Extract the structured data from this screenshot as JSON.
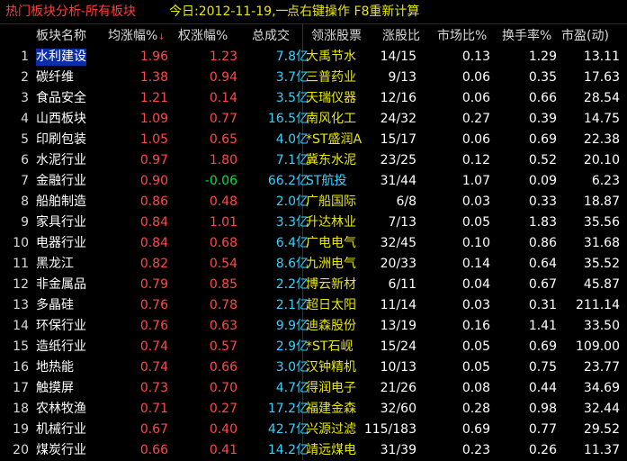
{
  "title_bar": {
    "title": "热门板块分析-所有板块",
    "date": "今日:2012-11-19,一",
    "hint": "点右键操作 F8重新计算"
  },
  "columns": {
    "name": "板块名称",
    "avg_change": "均涨幅%",
    "weighted_change": "权涨幅%",
    "volume": "总成交",
    "leading_stock": "领涨股票",
    "up_ratio": "涨股比",
    "market_ratio": "市场比%",
    "turnover": "换手率%",
    "pe": "市盈(动)",
    "sort_indicator": "↓"
  },
  "volume_unit": "亿",
  "rows": [
    {
      "num": "1",
      "name": "水利建设",
      "avg": "1.96",
      "wchg": "1.23",
      "vol": "7.8",
      "stock": "大禹节水",
      "ratio": "14/15",
      "mkt": "0.13",
      "turn": "1.29",
      "pe": "13.11"
    },
    {
      "num": "2",
      "name": "碳纤维",
      "avg": "1.38",
      "wchg": "0.94",
      "vol": "3.7",
      "stock": "三普药业",
      "ratio": "9/13",
      "mkt": "0.06",
      "turn": "0.35",
      "pe": "17.63"
    },
    {
      "num": "3",
      "name": "食品安全",
      "avg": "1.21",
      "wchg": "0.14",
      "vol": "3.5",
      "stock": "天瑞仪器",
      "ratio": "12/16",
      "mkt": "0.06",
      "turn": "0.66",
      "pe": "28.54"
    },
    {
      "num": "4",
      "name": "山西板块",
      "avg": "1.09",
      "wchg": "0.77",
      "vol": "16.5",
      "stock": "南风化工",
      "ratio": "24/32",
      "mkt": "0.27",
      "turn": "0.39",
      "pe": "14.75"
    },
    {
      "num": "5",
      "name": "印刷包装",
      "avg": "1.05",
      "wchg": "0.65",
      "vol": "4.0",
      "stock": "*ST盛润A",
      "ratio": "15/17",
      "mkt": "0.06",
      "turn": "0.69",
      "pe": "22.38"
    },
    {
      "num": "6",
      "name": "水泥行业",
      "avg": "0.97",
      "wchg": "1.80",
      "vol": "7.1",
      "stock": "冀东水泥",
      "ratio": "23/25",
      "mkt": "0.12",
      "turn": "0.52",
      "pe": "20.10"
    },
    {
      "num": "7",
      "name": "金融行业",
      "avg": "0.90",
      "wchg": "-0.06",
      "vol": "66.2",
      "stock": "ST航投",
      "ratio": "31/44",
      "mkt": "1.07",
      "turn": "0.09",
      "pe": "6.23"
    },
    {
      "num": "8",
      "name": "船舶制造",
      "avg": "0.86",
      "wchg": "0.48",
      "vol": "2.0",
      "stock": "广船国际",
      "ratio": "6/8",
      "mkt": "0.03",
      "turn": "0.33",
      "pe": "18.87"
    },
    {
      "num": "9",
      "name": "家具行业",
      "avg": "0.84",
      "wchg": "1.01",
      "vol": "3.3",
      "stock": "升达林业",
      "ratio": "7/13",
      "mkt": "0.05",
      "turn": "1.83",
      "pe": "35.56"
    },
    {
      "num": "10",
      "name": "电器行业",
      "avg": "0.84",
      "wchg": "0.68",
      "vol": "6.4",
      "stock": "广电电气",
      "ratio": "32/45",
      "mkt": "0.10",
      "turn": "0.86",
      "pe": "31.68"
    },
    {
      "num": "11",
      "name": "黑龙江",
      "avg": "0.82",
      "wchg": "0.54",
      "vol": "8.6",
      "stock": "九洲电气",
      "ratio": "20/33",
      "mkt": "0.14",
      "turn": "0.64",
      "pe": "35.52"
    },
    {
      "num": "12",
      "name": "非金属品",
      "avg": "0.79",
      "wchg": "0.85",
      "vol": "2.2",
      "stock": "博云新材",
      "ratio": "6/11",
      "mkt": "0.04",
      "turn": "0.67",
      "pe": "45.87"
    },
    {
      "num": "13",
      "name": "多晶硅",
      "avg": "0.76",
      "wchg": "0.78",
      "vol": "2.1",
      "stock": "超日太阳",
      "ratio": "11/14",
      "mkt": "0.03",
      "turn": "0.31",
      "pe": "211.14"
    },
    {
      "num": "14",
      "name": "环保行业",
      "avg": "0.76",
      "wchg": "0.63",
      "vol": "9.9",
      "stock": "迪森股份",
      "ratio": "13/19",
      "mkt": "0.16",
      "turn": "1.41",
      "pe": "33.50"
    },
    {
      "num": "15",
      "name": "造纸行业",
      "avg": "0.74",
      "wchg": "0.57",
      "vol": "2.9",
      "stock": "*ST石岘",
      "ratio": "15/24",
      "mkt": "0.05",
      "turn": "0.69",
      "pe": "109.00"
    },
    {
      "num": "16",
      "name": "地热能",
      "avg": "0.74",
      "wchg": "0.66",
      "vol": "3.0",
      "stock": "汉钟精机",
      "ratio": "10/13",
      "mkt": "0.05",
      "turn": "0.75",
      "pe": "23.77"
    },
    {
      "num": "17",
      "name": "触摸屏",
      "avg": "0.73",
      "wchg": "0.70",
      "vol": "4.7",
      "stock": "得润电子",
      "ratio": "21/26",
      "mkt": "0.08",
      "turn": "0.44",
      "pe": "34.69"
    },
    {
      "num": "18",
      "name": "农林牧渔",
      "avg": "0.71",
      "wchg": "0.27",
      "vol": "17.2",
      "stock": "福建金森",
      "ratio": "32/60",
      "mkt": "0.28",
      "turn": "0.98",
      "pe": "32.44"
    },
    {
      "num": "19",
      "name": "机械行业",
      "avg": "0.67",
      "wchg": "0.40",
      "vol": "42.7",
      "stock": "兴源过滤",
      "ratio": "115/183",
      "mkt": "0.69",
      "turn": "0.77",
      "pe": "29.52"
    },
    {
      "num": "20",
      "name": "煤炭行业",
      "avg": "0.66",
      "wchg": "0.41",
      "vol": "14.2",
      "stock": "靖远煤电",
      "ratio": "31/39",
      "mkt": "0.23",
      "turn": "0.26",
      "pe": "11.37"
    }
  ],
  "colors": {
    "background": "#000000",
    "title": "#ff3b3b",
    "yellow_text": "#e8e800",
    "up": "#ff4848",
    "down": "#00e040",
    "volume": "#33d2ff",
    "selection": "#0a2ea8"
  }
}
